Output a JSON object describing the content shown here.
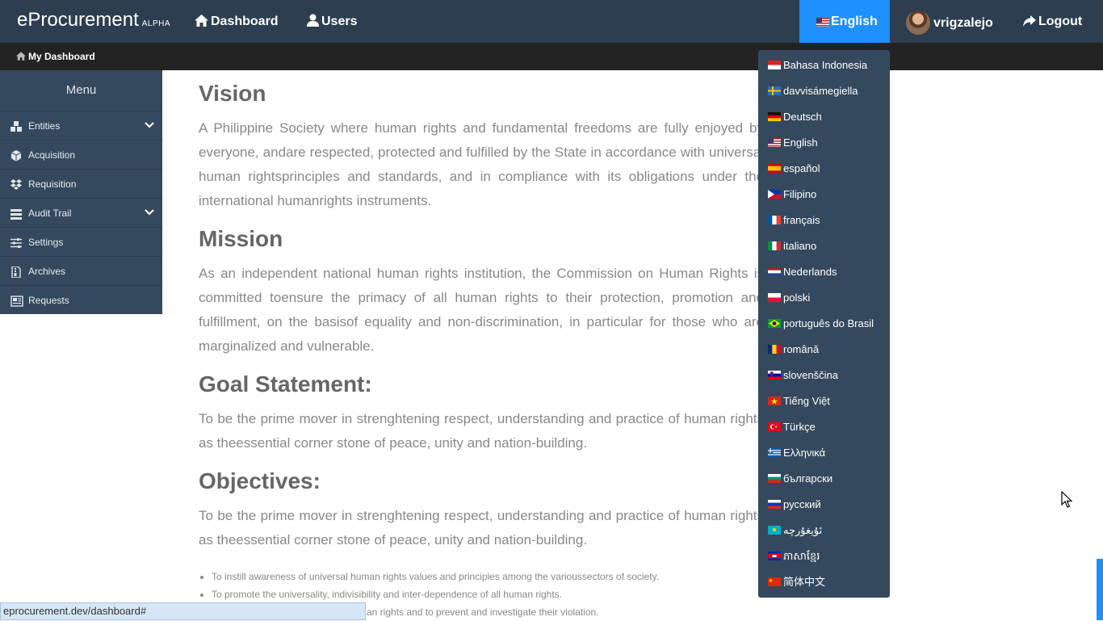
{
  "app": {
    "brand": "eProcurement",
    "brand_tag": "ALPHA"
  },
  "nav": {
    "dashboard": "Dashboard",
    "users": "Users",
    "language": "English",
    "username": "vrigzalejo",
    "logout": "Logout"
  },
  "breadcrumb": {
    "label": "My Dashboard"
  },
  "sidebar": {
    "title": "Menu",
    "items": [
      {
        "label": "Entities",
        "icon": "cubes-icon"
      },
      {
        "label": "Acquisition",
        "icon": "cube-icon"
      },
      {
        "label": "Requisition",
        "icon": "dropbox-icon"
      },
      {
        "label": "Audit Trail",
        "icon": "tasks-icon"
      },
      {
        "label": "Settings",
        "icon": "sliders-icon"
      },
      {
        "label": "Archives",
        "icon": "file-archive-icon"
      },
      {
        "label": "Requests",
        "icon": "newspaper-icon"
      }
    ]
  },
  "content": {
    "vision_title": "Vision",
    "vision_text": "A Philippine Society where human rights and fundamental freedoms are fully enjoyed by everyone, andare respected, protected and fulfilled by the State in accordance with universal human rightsprinciples and standards, and in compliance with its obligations under the international humanrights instruments.",
    "mission_title": "Mission",
    "mission_text": "As an independent national human rights institution, the Commission on Human Rights is committed toensure the primacy of all human rights to their protection, promotion and fulfillment, on the basisof equality and non-discrimination, in particular for those who are marginalized and vulnerable.",
    "goal_title": "Goal Statement:",
    "goal_text": "To be the prime mover in strenghtening respect, understanding and practice of human rights as theessential corner stone of peace, unity and nation-building.",
    "objectives_title": "Objectives:",
    "objectives_text": "To be the prime mover in strenghtening respect, understanding and practice of human rights as theessential corner stone of peace, unity and nation-building.",
    "objectives_list": [
      "To instill awareness of universal human rights values and principles among the varioussectors of society.",
      "To promote the universality, indivisibility and inter-dependence of all human rights.",
      "an rights and to prevent and investigate their violation."
    ]
  },
  "languages": [
    "Bahasa Indonesia",
    "davvisámegiella",
    "Deutsch",
    "English",
    "español",
    "Filipino",
    "français",
    "italiano",
    "Nederlands",
    "polski",
    "português do Brasil",
    "română",
    "slovenščina",
    "Tiếng Việt",
    "Türkçe",
    "Ελληνικά",
    "български",
    "русский",
    "ئۇيغۇرچە",
    "ភាសាខ្មែរ",
    "简体中文"
  ],
  "status_url": "eprocurement.dev/dashboard#",
  "colors": {
    "topbar": "#2c3e50",
    "accent": "#1e90ff",
    "sidebar": "#34495e"
  }
}
